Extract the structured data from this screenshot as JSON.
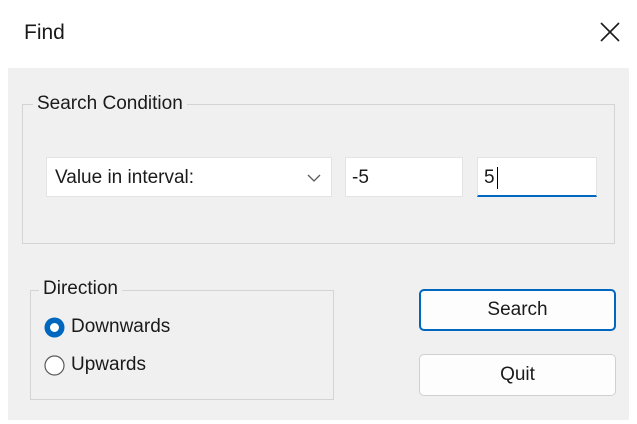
{
  "dialog": {
    "title": "Find",
    "close_icon": "close-icon"
  },
  "search_condition": {
    "legend": "Search Condition",
    "condition_select": {
      "selected": "Value in interval:",
      "icon": "chevron-down-icon"
    },
    "min_value": "-5",
    "max_value": "5"
  },
  "direction": {
    "legend": "Direction",
    "options": [
      {
        "label": "Downwards",
        "selected": true
      },
      {
        "label": "Upwards",
        "selected": false
      }
    ]
  },
  "buttons": {
    "search_label": "Search",
    "quit_label": "Quit"
  },
  "colors": {
    "accent": "#0067c0",
    "window_bg": "#f0f0f0",
    "titlebar_bg": "#ffffff"
  }
}
